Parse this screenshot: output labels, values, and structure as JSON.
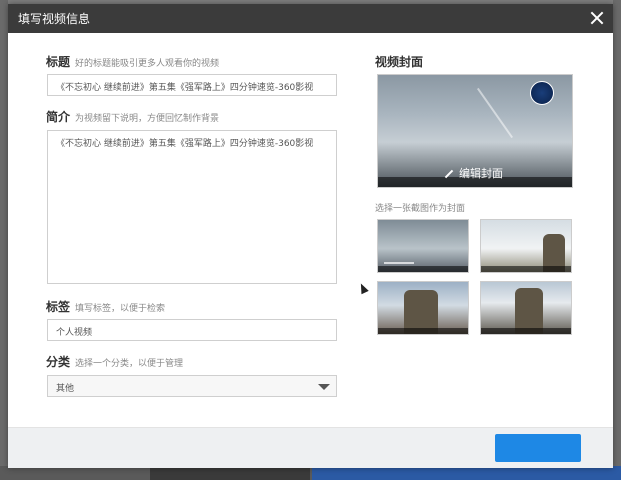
{
  "dialog": {
    "title": "填写视频信息"
  },
  "form": {
    "title_label": "标题",
    "title_hint": "好的标题能吸引更多人观看你的视频",
    "title_value": "《不忘初心 继续前进》第五集《强军路上》四分钟速览-360影视",
    "intro_label": "简介",
    "intro_hint": "为视频留下说明，方便回忆制作背景",
    "intro_value": "《不忘初心 继续前进》第五集《强军路上》四分钟速览-360影视",
    "tag_label": "标签",
    "tag_hint": "填写标签，以便于检索",
    "tag_value": "个人视频",
    "category_label": "分类",
    "category_hint": "选择一个分类，以便于管理",
    "category_value": "其他"
  },
  "cover": {
    "label": "视频封面",
    "edit_button": "编辑封面",
    "choose_hint": "选择一张截图作为封面"
  },
  "colors": {
    "titlebar": "#3b3b3b",
    "accent": "#1e88e5"
  }
}
